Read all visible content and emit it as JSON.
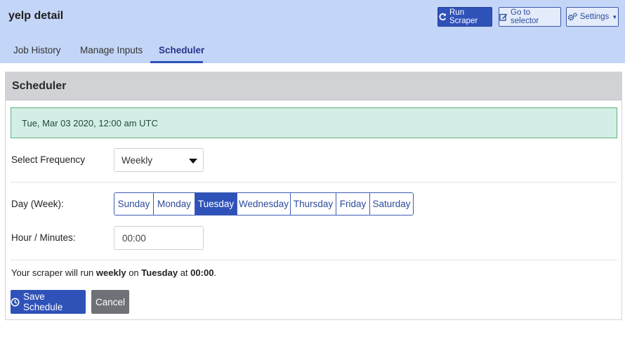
{
  "app": {
    "title": "yelp detail"
  },
  "actions": {
    "run_scraper": "Run Scraper",
    "go_to_selector": "Go to selector",
    "settings": "Settings"
  },
  "tabs": [
    {
      "label": "Job History",
      "active": false
    },
    {
      "label": "Manage Inputs",
      "active": false
    },
    {
      "label": "Scheduler",
      "active": true
    }
  ],
  "panel": {
    "title": "Scheduler",
    "datetime": "Tue, Mar 03 2020, 12:00 am UTC"
  },
  "frequency": {
    "label": "Select Frequency",
    "value": "Weekly"
  },
  "day_week": {
    "label": "Day (Week):",
    "days": [
      "Sunday",
      "Monday",
      "Tuesday",
      "Wednesday",
      "Thursday",
      "Friday",
      "Saturday"
    ],
    "selected": "Tuesday"
  },
  "hour_minutes": {
    "label": "Hour / Minutes:",
    "value": "00:00"
  },
  "summary": {
    "prefix": "Your scraper will run",
    "frequency": "weekly",
    "on": "on",
    "day": "Tuesday",
    "at": "at",
    "time": "00:00",
    "suffix": "."
  },
  "buttons": {
    "save": "Save Schedule",
    "cancel": "Cancel"
  },
  "colors": {
    "header_bg": "#c4d6f7",
    "primary": "#2f52b9",
    "success_bg": "#d3eee6",
    "success_border": "#62b37a",
    "secondary": "#6e7276"
  },
  "icons": {
    "run_scraper": "refresh-icon",
    "go_to_selector": "edit-icon",
    "settings": "gears-icon",
    "save": "clock-icon"
  }
}
